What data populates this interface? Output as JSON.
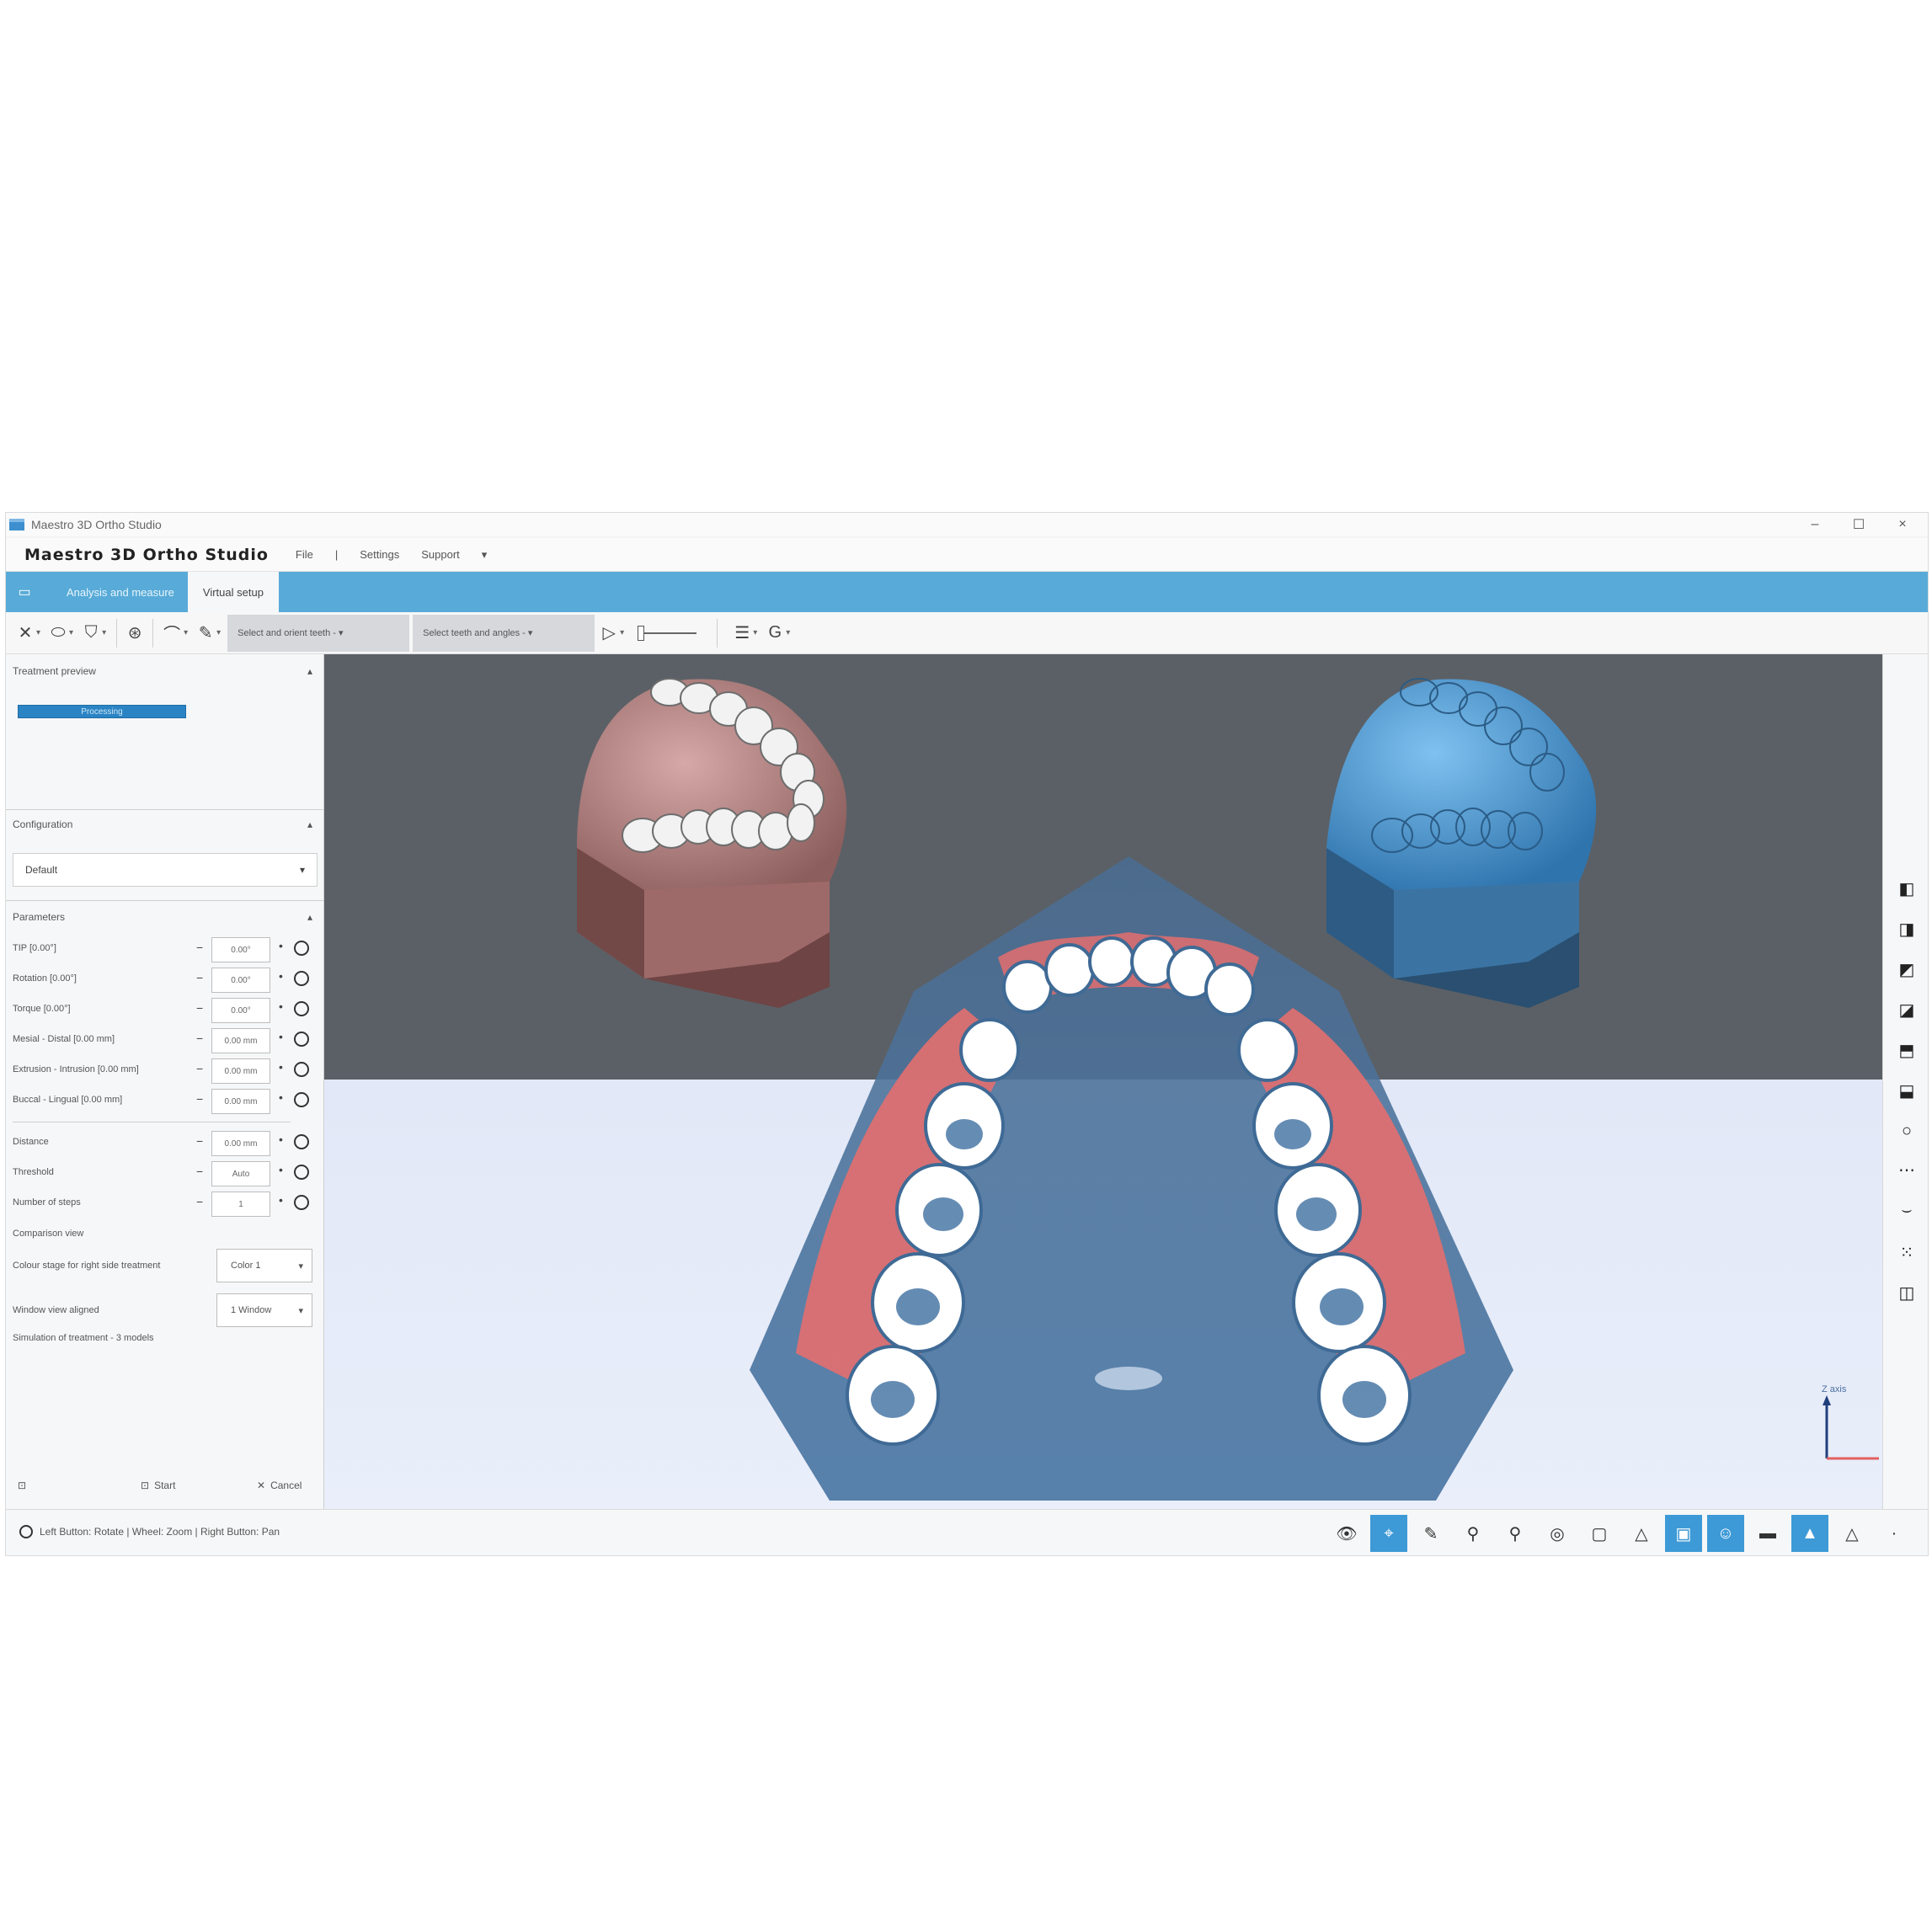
{
  "window": {
    "title": "Maestro 3D Ortho Studio",
    "controls": {
      "minimize": "–",
      "maximize": "☐",
      "close": "×"
    }
  },
  "menubar": {
    "brand": "Maestro 3D Ortho Studio",
    "items": [
      "File",
      "|",
      "Settings",
      "Support",
      "▾"
    ]
  },
  "tabs": [
    {
      "label": "Analysis and measure",
      "active": false
    },
    {
      "label": "Virtual setup",
      "active": true
    }
  ],
  "toolbar": {
    "select1": "Select and orient teeth - ▾",
    "select2": "Select teeth and angles - ▾"
  },
  "left_panel": {
    "section1_title": "Treatment preview",
    "progress_label": "Processing",
    "config_title": "Configuration",
    "config_value": "Default",
    "params_title": "Parameters",
    "params": [
      {
        "label": "TIP [0.00°]",
        "value": "0.00°"
      },
      {
        "label": "Rotation [0.00°]",
        "value": "0.00°"
      },
      {
        "label": "Torque [0.00°]",
        "value": "0.00°"
      },
      {
        "label": "Mesial - Distal [0.00 mm]",
        "value": "0.00 mm"
      },
      {
        "label": "Extrusion - Intrusion [0.00 mm]",
        "value": "0.00 mm"
      },
      {
        "label": "Buccal - Lingual [0.00 mm]",
        "value": "0.00 mm"
      }
    ],
    "params2": [
      {
        "label": "Distance",
        "value": "0.00 mm"
      },
      {
        "label": "Threshold",
        "value": "Auto"
      },
      {
        "label": "Number of steps",
        "value": "1"
      }
    ],
    "compare_label": "Comparison view",
    "dropdowns": [
      {
        "label": "Colour stage for right side treatment",
        "value": "Color 1"
      },
      {
        "label": "Window view aligned",
        "value": "1 Window"
      }
    ],
    "footnote": "Simulation of treatment - 3 models",
    "footer": {
      "ok": "Start",
      "cancel": "Cancel"
    }
  },
  "viewport": {
    "axis_label": "Z axis",
    "colors": {
      "top_bg": "#5b6066",
      "bottom_bg": "#e2e8f7",
      "pink_model": "#b88786",
      "blue_model": "#58a8e6",
      "overlay_red": "#e07070",
      "overlay_blue": "#476f96"
    }
  },
  "status": {
    "text": "Left Button: Rotate | Wheel: Zoom | Right Button: Pan"
  },
  "view_tools": [
    {
      "icon": "eye-icon",
      "glyph": "👁",
      "on": false
    },
    {
      "icon": "select-icon",
      "glyph": "⌖",
      "on": true
    },
    {
      "icon": "pen-icon",
      "glyph": "✎",
      "on": false
    },
    {
      "icon": "zoom-out-icon",
      "glyph": "⚲",
      "on": false
    },
    {
      "icon": "zoom-in-icon",
      "glyph": "⚲",
      "on": false
    },
    {
      "icon": "target-icon",
      "glyph": "◎",
      "on": false
    },
    {
      "icon": "frame-icon",
      "glyph": "▢",
      "on": false
    },
    {
      "icon": "warning-icon",
      "glyph": "△",
      "on": false
    },
    {
      "icon": "monitor-icon",
      "glyph": "▣",
      "on": true
    },
    {
      "icon": "user-icon",
      "glyph": "☺",
      "on": true
    },
    {
      "icon": "bar-icon",
      "glyph": "▬",
      "on": false
    },
    {
      "icon": "triangle-fill-icon",
      "glyph": "▲",
      "on": true
    },
    {
      "icon": "triangle-outline-icon",
      "glyph": "△",
      "on": false
    },
    {
      "icon": "more-icon",
      "glyph": "·",
      "on": false
    }
  ],
  "right_tools": [
    {
      "icon": "cube-front-icon",
      "glyph": "◧"
    },
    {
      "icon": "cube-back-icon",
      "glyph": "◨"
    },
    {
      "icon": "cube-left-icon",
      "glyph": "◩"
    },
    {
      "icon": "cube-right-icon",
      "glyph": "◪"
    },
    {
      "icon": "cube-top-icon",
      "glyph": "⬒"
    },
    {
      "icon": "cube-bottom-icon",
      "glyph": "⬓"
    },
    {
      "icon": "circle-icon",
      "glyph": "○"
    },
    {
      "icon": "dots-icon",
      "glyph": "⋯"
    },
    {
      "icon": "curve-icon",
      "glyph": "⌣"
    },
    {
      "icon": "grid-icon",
      "glyph": "⁙"
    },
    {
      "icon": "columns-icon",
      "glyph": "◫"
    }
  ]
}
